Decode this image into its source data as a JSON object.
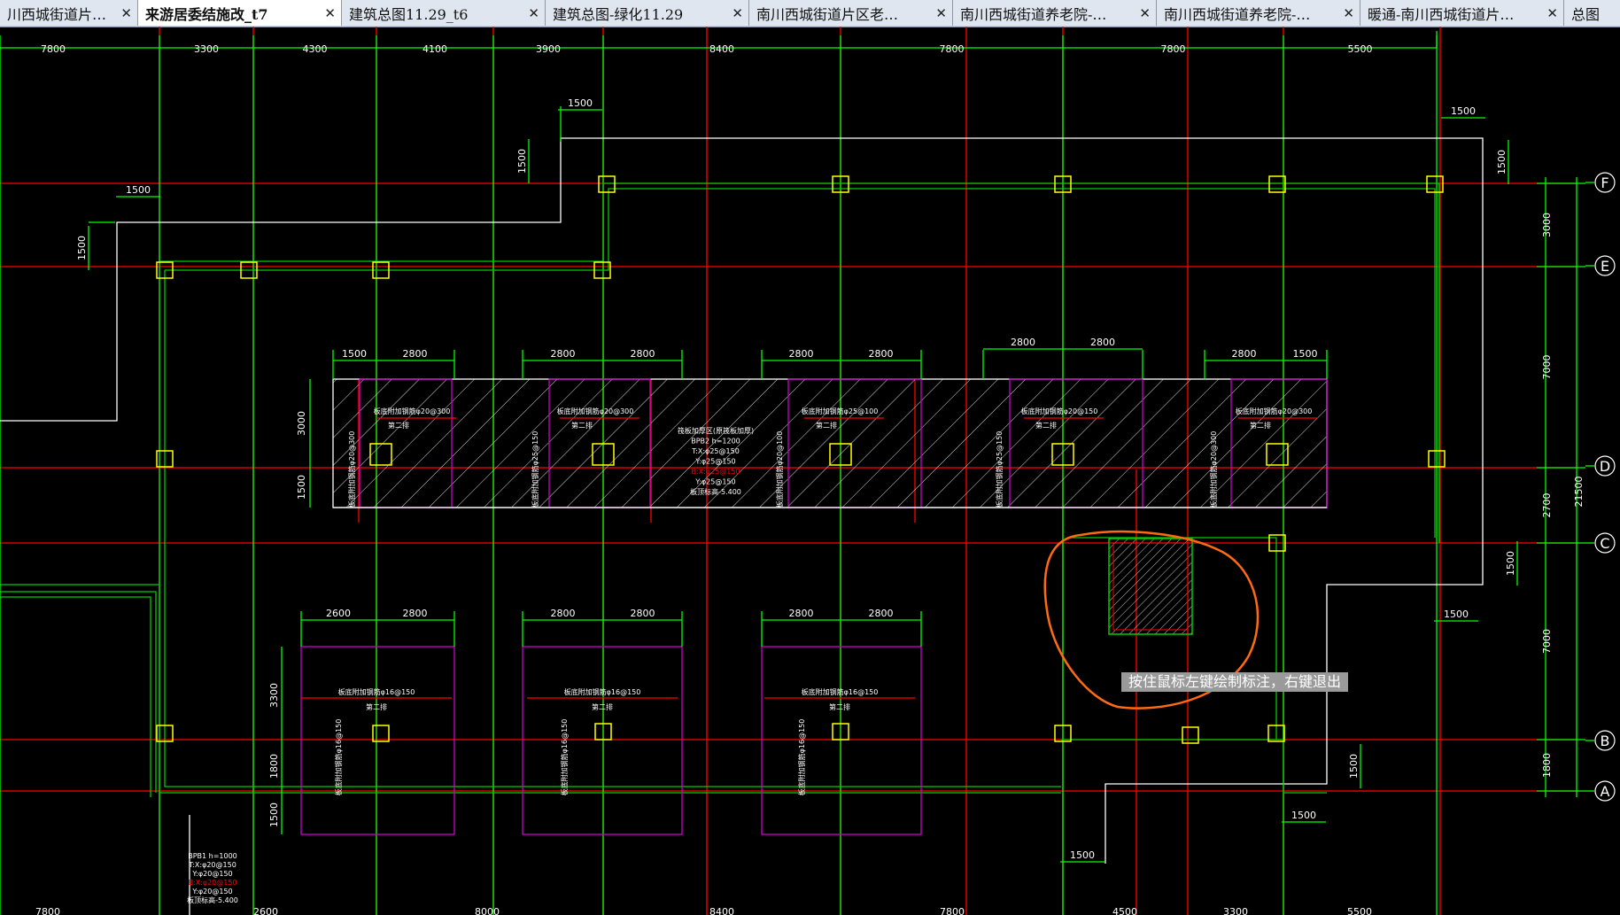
{
  "tabs": [
    {
      "label": "川西城街道片…",
      "active": false
    },
    {
      "label": "来游居委结施改_t7",
      "active": true
    },
    {
      "label": "建筑总图11.29_t6",
      "active": false
    },
    {
      "label": "建筑总图-绿化11.29",
      "active": false
    },
    {
      "label": "南川西城街道片区老…",
      "active": false
    },
    {
      "label": "南川西城街道养老院-…",
      "active": false
    },
    {
      "label": "南川西城街道养老院-…",
      "active": false
    },
    {
      "label": "暖通-南川西城街道片…",
      "active": false
    },
    {
      "label": "总图",
      "active": false
    }
  ],
  "close_glyph": "✕",
  "tooltip": "按住鼠标左键绘制标注，右键退出",
  "colors": {
    "background": "#000000",
    "axis": "#ff0000",
    "dimension": "#00ff00",
    "outline": "#ffffff",
    "column": "#ffff00",
    "slab": "#cc00cc",
    "markup": "#ff6a13",
    "wall": "#00cc00"
  },
  "dims": {
    "top": [
      "7800",
      "3300",
      "4300",
      "4100",
      "3900",
      "8400",
      "7800",
      "7800",
      "5500"
    ],
    "bottom": [
      "7800",
      "2600",
      "8000",
      "8400",
      "7800",
      "4500",
      "3300",
      "5500"
    ],
    "right": [
      "3000",
      "7000",
      "2700",
      "7000",
      "1800"
    ],
    "right_total": "21500",
    "offset_1500": "1500",
    "band_upper": [
      "1500",
      "2800",
      "2800",
      "2800",
      "2800",
      "2800",
      "2800",
      "2800",
      "2800",
      "1500"
    ],
    "band_upper_left": [
      "3000",
      "1500"
    ],
    "band_lower": [
      "2600",
      "2800",
      "2800",
      "2800",
      "2800",
      "2800"
    ],
    "band_lower_left": [
      "3300",
      "1800",
      "1500"
    ]
  },
  "axes": [
    "F",
    "E",
    "D",
    "C",
    "B",
    "A"
  ],
  "slab_notes": {
    "upper_top": [
      "板底附加钢筋φ20@300",
      "板底附加钢筋φ20@300",
      "板底附加钢筋φ25@100",
      "板底附加钢筋φ20@150",
      "板底附加钢筋φ20@300"
    ],
    "upper_side": [
      "板底附加钢筋φ20@300",
      "板底附加钢筋φ25@150",
      "板底附加钢筋φ20@100",
      "板底附加钢筋φ25@150",
      "板底附加钢筋φ20@300"
    ],
    "layer": "第二排",
    "lower_top": [
      "板底附加钢筋φ16@150",
      "板底附加钢筋φ16@150",
      "板底附加钢筋φ16@150"
    ],
    "lower_side": [
      "板底附加钢筋φ16@150",
      "板底附加钢筋φ16@150",
      "板底附加钢筋φ16@150"
    ]
  },
  "bpb2": [
    "筏板加厚区(原筏板加厚)",
    "BPB2  h=1200",
    "T:X:φ25@150",
    "Y:φ25@150",
    "B:X:φ25@150",
    "Y:φ25@150",
    "板顶标高-5.400"
  ],
  "bpb1": [
    "BPB1  h=1000",
    "T:X:φ20@150",
    "Y:φ20@150",
    "B:X:φ20@150",
    "Y:φ20@150",
    "板顶标高-5.400"
  ]
}
